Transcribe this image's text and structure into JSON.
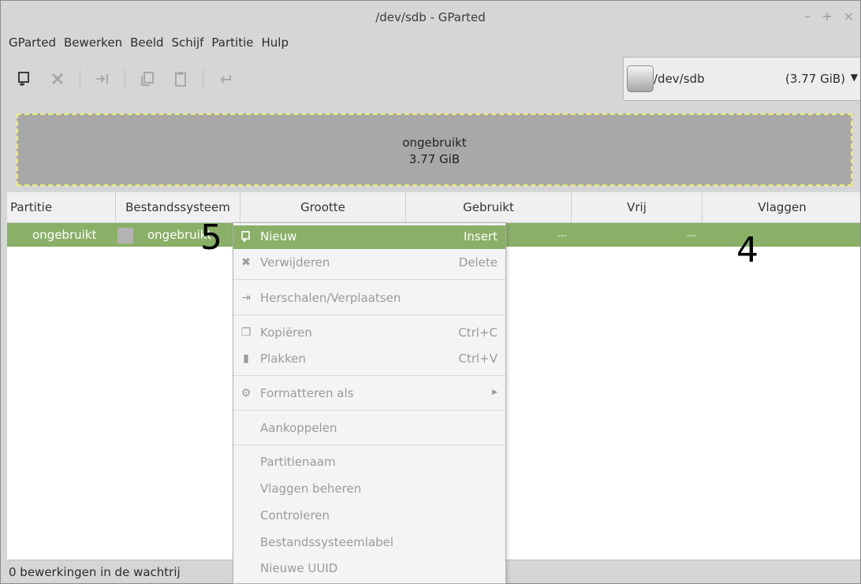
{
  "window": {
    "title": "/dev/sdb - GParted",
    "controls": [
      "–",
      "+",
      "×"
    ]
  },
  "menubar": [
    "GParted",
    "Bewerken",
    "Beeld",
    "Schijf",
    "Partitie",
    "Hulp"
  ],
  "toolbar": {
    "icons": [
      "new-partition-icon",
      "delete-icon",
      "resize-icon",
      "copy-icon",
      "paste-icon",
      "undo-icon"
    ]
  },
  "device": {
    "name": "/dev/sdb",
    "size": "(3.77 GiB)"
  },
  "map": {
    "label": "ongebruikt",
    "size": "3.77 GiB"
  },
  "table": {
    "headers": [
      "Partitie",
      "Bestandssysteem",
      "Grootte",
      "Gebruikt",
      "Vrij",
      "Vlaggen"
    ],
    "row": {
      "partition": "ongebruikt",
      "filesystem": "ongebruikt",
      "used": "---",
      "free": "---"
    }
  },
  "context_menu": {
    "items": [
      {
        "label": "Nieuw",
        "shortcut": "Insert"
      },
      {
        "label": "Verwijderen",
        "shortcut": "Delete"
      },
      {
        "label": "Herschalen/Verplaatsen",
        "shortcut": ""
      },
      {
        "label": "Kopiëren",
        "shortcut": "Ctrl+C"
      },
      {
        "label": "Plakken",
        "shortcut": "Ctrl+V"
      },
      {
        "label": "Formatteren als",
        "shortcut": ""
      },
      {
        "label": "Aankoppelen",
        "shortcut": ""
      },
      {
        "label": "Partitienaam",
        "shortcut": ""
      },
      {
        "label": "Vlaggen beheren",
        "shortcut": ""
      },
      {
        "label": "Controleren",
        "shortcut": ""
      },
      {
        "label": "Bestandssysteemlabel",
        "shortcut": ""
      },
      {
        "label": "Nieuwe UUID",
        "shortcut": ""
      }
    ]
  },
  "status": "0 bewerkingen in de wachtrij",
  "annotations": {
    "a": "5",
    "b": "4"
  },
  "colors": {
    "selection": "#8ab068",
    "unallocated": "#a8a8a8",
    "border_dash": "#f0f070"
  }
}
